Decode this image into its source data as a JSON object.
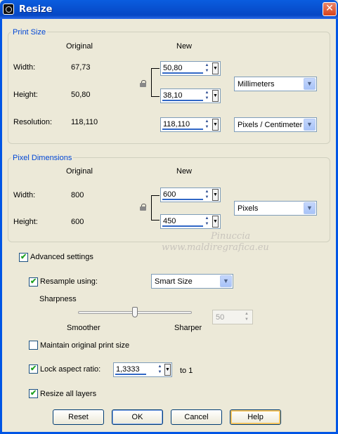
{
  "window": {
    "title": "Resize",
    "close_glyph": "✕"
  },
  "print_size": {
    "title": "Print Size",
    "col_original": "Original",
    "col_new": "New",
    "width_label": "Width:",
    "height_label": "Height:",
    "resolution_label": "Resolution:",
    "width_original": "67,73",
    "height_original": "50,80",
    "resolution_original": "118,110",
    "width_new": "50,80",
    "height_new": "38,10",
    "resolution_new": "118,110",
    "unit": "Millimeters",
    "resolution_unit": "Pixels / Centimeter"
  },
  "pixel_dimensions": {
    "title": "Pixel Dimensions",
    "col_original": "Original",
    "col_new": "New",
    "width_label": "Width:",
    "height_label": "Height:",
    "width_original": "800",
    "height_original": "600",
    "width_new": "600",
    "height_new": "450",
    "unit": "Pixels"
  },
  "advanced": {
    "label": "Advanced settings",
    "resample_label": "Resample using:",
    "resample_value": "Smart Size",
    "sharpness_label": "Sharpness",
    "smoother_label": "Smoother",
    "sharper_label": "Sharper",
    "sharpness_value": "50",
    "sharpness_level": 0.5,
    "maintain_label": "Maintain original print size",
    "lock_aspect_label": "Lock aspect ratio:",
    "aspect_value": "1,3333",
    "to_one_label": "to 1",
    "resize_all_label": "Resize all layers",
    "checked": {
      "advanced": true,
      "resample": true,
      "maintain": false,
      "lock_aspect": true,
      "resize_all": true
    }
  },
  "buttons": {
    "reset": "Reset",
    "ok": "OK",
    "cancel": "Cancel",
    "help": "Help"
  },
  "watermark": {
    "line1": "Pinuccia",
    "line2": "www.maldiregrafica.eu"
  },
  "colors": {
    "title_bar": "#0a5ddf",
    "group_title": "#0046d5",
    "dialog_bg": "#ece9d8",
    "check": "#21a121"
  }
}
